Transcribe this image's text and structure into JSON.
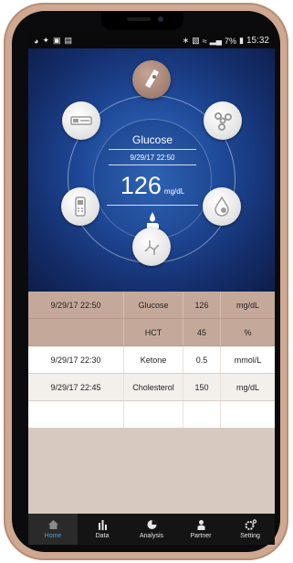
{
  "status_bar": {
    "left_icons": [
      "wifi-icon",
      "wrench-icon",
      "gallery-icon",
      "calendar-icon"
    ],
    "right_icons": [
      "bluetooth-icon",
      "nfc-icon",
      "wifi-off-icon",
      "signal-icon"
    ],
    "battery": "7%",
    "time": "15:32"
  },
  "dashboard": {
    "title": "Glucose",
    "date": "9/29/17 22:50",
    "value": "126",
    "unit": "mg/dL",
    "icons": [
      "test-strip-icon",
      "molecule-icon",
      "droplet-icon",
      "chemistry-icon",
      "meter-icon",
      "cholesterol-icon"
    ]
  },
  "records": [
    {
      "datetime": "9/29/17 22:50",
      "type": "Glucose",
      "value": "126",
      "unit": "mg/dL"
    },
    {
      "datetime": "",
      "type": "HCT",
      "value": "45",
      "unit": "%"
    },
    {
      "datetime": "9/29/17 22:30",
      "type": "Ketone",
      "value": "0.5",
      "unit": "mmol/L"
    },
    {
      "datetime": "9/29/17 22:45",
      "type": "Cholesterol",
      "value": "150",
      "unit": "mg/dL"
    },
    {
      "datetime": "",
      "type": "",
      "value": "",
      "unit": ""
    }
  ],
  "tabs": [
    {
      "label": "Home",
      "icon": "home-icon",
      "active": true
    },
    {
      "label": "Data",
      "icon": "bar-chart-icon",
      "active": false
    },
    {
      "label": "Analysis",
      "icon": "pie-chart-icon",
      "active": false
    },
    {
      "label": "Partner",
      "icon": "partner-icon",
      "active": false
    },
    {
      "label": "Setting",
      "icon": "gear-icon",
      "active": false
    }
  ],
  "colors": {
    "hero_center": "#3a6fbe",
    "hero_edge": "#0d1d4a",
    "selected_row": "#c4a99a",
    "active_tab_label": "#4a9fe6"
  }
}
